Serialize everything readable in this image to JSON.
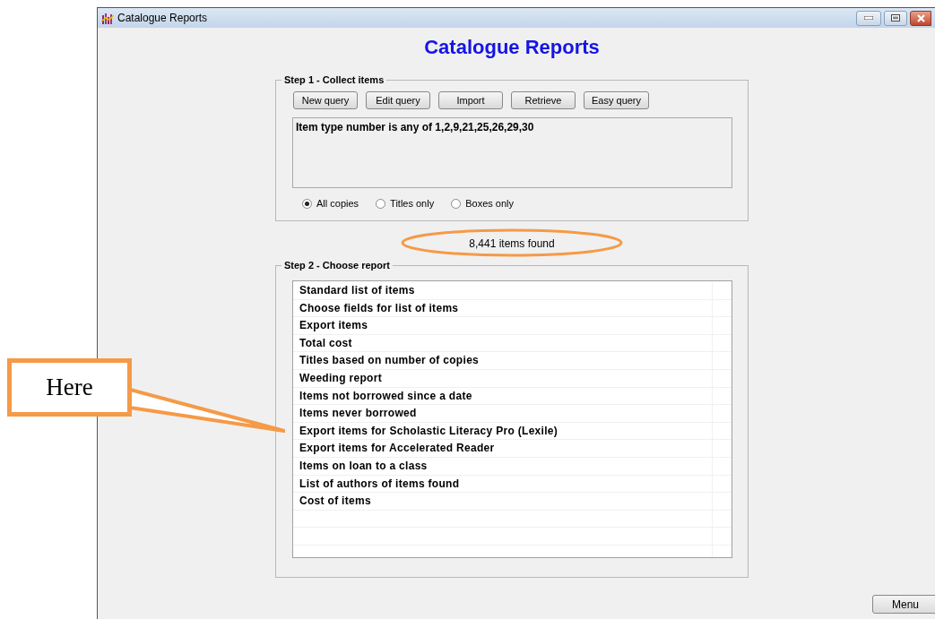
{
  "window": {
    "title": "Catalogue Reports"
  },
  "heading": "Catalogue Reports",
  "step1": {
    "legend": "Step 1 - Collect items",
    "buttons": [
      "New query",
      "Edit query",
      "Import",
      "Retrieve",
      "Easy query"
    ],
    "query": "Item type number is any of 1,2,9,21,25,26,29,30",
    "options": [
      {
        "label": "All copies",
        "selected": true
      },
      {
        "label": "Titles only",
        "selected": false
      },
      {
        "label": "Boxes only",
        "selected": false
      }
    ]
  },
  "found": "8,441 items found",
  "step2": {
    "legend": "Step 2 - Choose report",
    "reports": [
      {
        "label": "Standard list of items",
        "selected": false
      },
      {
        "label": "Choose fields for list of items",
        "selected": false
      },
      {
        "label": "Export items",
        "selected": false
      },
      {
        "label": "Total cost",
        "selected": false
      },
      {
        "label": "Titles based on number of copies",
        "selected": false
      },
      {
        "label": "Weeding report",
        "selected": false
      },
      {
        "label": "Items not borrowed since a date",
        "selected": false
      },
      {
        "label": "Items never borrowed",
        "selected": false
      },
      {
        "label": "Export items for Scholastic Literacy Pro (Lexile)",
        "selected": false
      },
      {
        "label": "Export items for Accelerated Reader",
        "selected": false
      },
      {
        "label": "Items on loan to a class",
        "selected": false
      },
      {
        "label": "List of authors of items found",
        "selected": false
      },
      {
        "label": "Cost of items",
        "selected": false
      }
    ]
  },
  "menu_button": "Menu",
  "callout": {
    "text": "Here"
  }
}
